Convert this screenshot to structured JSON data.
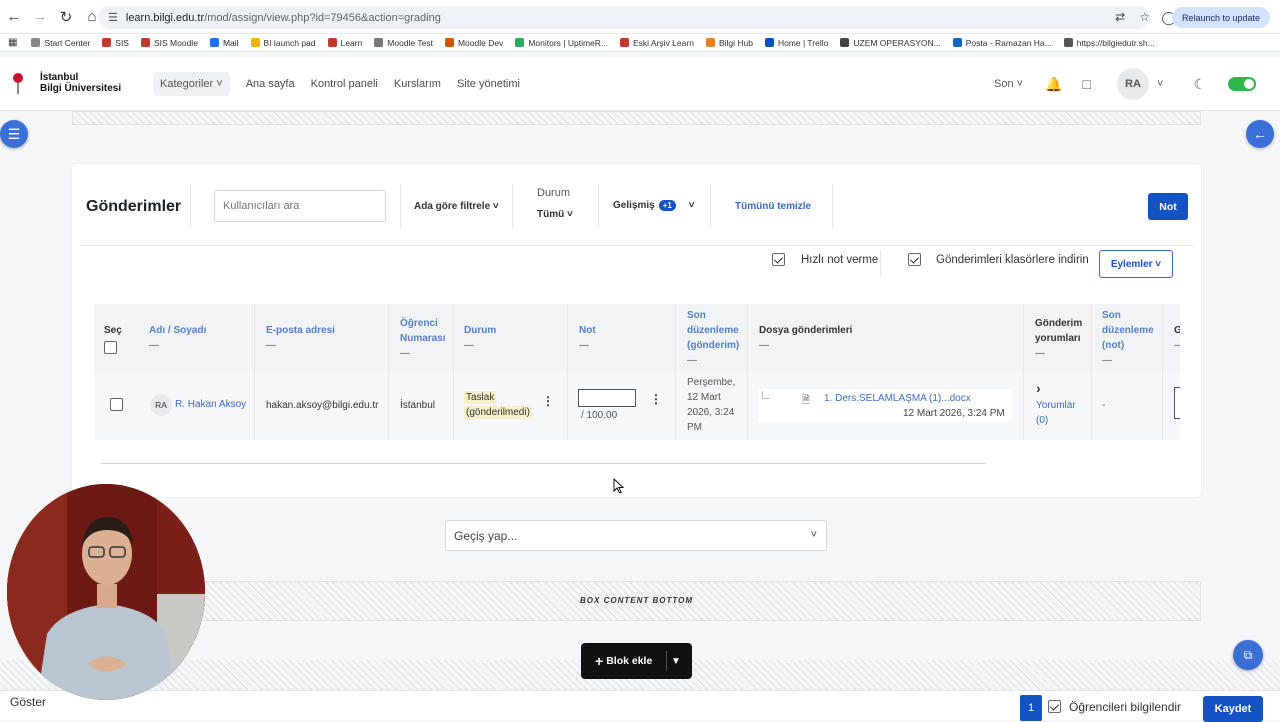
{
  "browser": {
    "url_host": "learn.bilgi.edu.tr",
    "url_path": "/mod/assign/view.php?id=79456&action=grading",
    "relaunch_label": "Relaunch to update"
  },
  "bookmarks": [
    {
      "label": "Start Center",
      "color": "#888888"
    },
    {
      "label": "SIS",
      "color": "#c0392b"
    },
    {
      "label": "SIS Moodle",
      "color": "#c0392b"
    },
    {
      "label": "Mail",
      "color": "#1a73e8"
    },
    {
      "label": "BI launch pad",
      "color": "#f0b400"
    },
    {
      "label": "Learn",
      "color": "#c0392b"
    },
    {
      "label": "Moodle Test",
      "color": "#777777"
    },
    {
      "label": "Moodle Dev",
      "color": "#d35400"
    },
    {
      "label": "Monitors | UptimeR...",
      "color": "#27ae60"
    },
    {
      "label": "Eski Arşiv Learn",
      "color": "#c0392b"
    },
    {
      "label": "Bilgi Hub",
      "color": "#e67e22"
    },
    {
      "label": "Home | Trello",
      "color": "#0052cc"
    },
    {
      "label": "UZEM OPERASYON...",
      "color": "#444444"
    },
    {
      "label": "Posta - Ramazan Ha...",
      "color": "#1565c0"
    },
    {
      "label": "https://bilgiedutr.sh...",
      "color": "#555555"
    }
  ],
  "site": {
    "logo_line1": "İstanbul",
    "logo_line2": "Bilgi Üniversitesi",
    "menu": {
      "categories": "Kategoriler",
      "home": "Ana sayfa",
      "dashboard": "Kontrol paneli",
      "courses": "Kurslarım",
      "admin": "Site yönetimi"
    },
    "lang": "Son",
    "user_initials": "RA"
  },
  "grading": {
    "title": "Gönderimler",
    "search_placeholder": "Kullanıcıları ara",
    "name_filter": "Ada göre filtrele",
    "status_label": "Durum",
    "status_value": "Tümü",
    "advanced_label": "Gelişmiş",
    "advanced_badge": "+1",
    "clear_all": "Tümünü temizle",
    "grade_button": "Not",
    "quick_grading": "Hızlı not verme",
    "download_folders": "Gönderimleri klasörlere indirin",
    "actions": "Eylemler",
    "headers": {
      "select": "Seç",
      "name": "Adı / Soyadı",
      "email": "E-posta adresi",
      "student_no_1": "Öğrenci",
      "student_no_2": "Numarası",
      "status": "Durum",
      "grade": "Not",
      "last_mod_sub_1": "Son",
      "last_mod_sub_2": "düzenleme",
      "last_mod_sub_3": "(gönderim)",
      "files": "Dosya gönderimleri",
      "comments_1": "Gönderim",
      "comments_2": "yorumları",
      "last_mod_grade_1": "Son",
      "last_mod_grade_2": "düzenleme",
      "last_mod_grade_3": "(not)",
      "next_col": "G",
      "dash": "—"
    },
    "row": {
      "initials": "RA",
      "name": "R. Hakan Aksoy",
      "email": "hakan.aksoy@bilgi.edu.tr",
      "student_no": "İstanbul",
      "status_1": "Taslak",
      "status_2": "(gönderilmedi)",
      "grade_value": "",
      "grade_max": "/ 100,00",
      "modified_1": "Perşembe,",
      "modified_2": "12 Mart",
      "modified_3": "2026, 3:24",
      "modified_4": "PM",
      "file_name": "1. Ders.SELAMLAŞMA (1)...docx",
      "file_date": "12 Mart 2026, 3:24 PM",
      "comments_1": "Yorumlar",
      "comments_2": "(0)",
      "grade_modified": "-"
    },
    "jump_placeholder": "Geçiş yap...",
    "box_bottom": "BOX CONTENT BOTTOM",
    "add_block": "Blok ekle"
  },
  "footer": {
    "show_label": "Göster",
    "page_number": "1",
    "notify_label": "Öğrencileri bilgilendir",
    "save_label": "Kaydet"
  }
}
